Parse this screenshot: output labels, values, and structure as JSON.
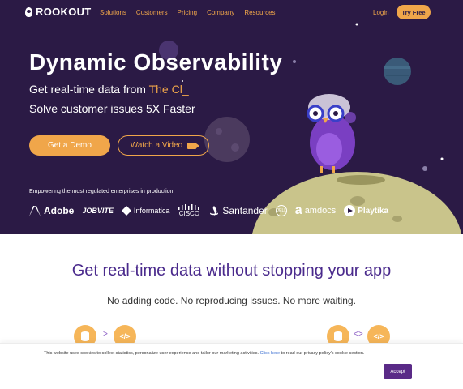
{
  "nav": {
    "logo_text": "ROOKOUT",
    "menu": [
      "Solutions",
      "Customers",
      "Pricing",
      "Company",
      "Resources"
    ],
    "login": "Login",
    "try_free": "Try Free"
  },
  "hero": {
    "title": "Dynamic Observability",
    "subtitle_prefix": "Get real-time data from ",
    "subtitle_highlight": "The Cl_",
    "subtitle_line2": "Solve customer issues 5X Faster",
    "get_demo": "Get a Demo",
    "watch_video": "Watch a Video",
    "empower_text": "Empowering the most regulated enterprises in production",
    "logos": [
      "Adobe",
      "JOBVITE",
      "Informatica",
      "CISCO",
      "Santander",
      "DELL",
      "amdocs",
      "Playtika"
    ]
  },
  "section": {
    "heading": "Get real-time data without stopping your app",
    "subheading": "No adding code. No reproducing issues. No more waiting.",
    "arrow1": ">",
    "arrow2": "<>",
    "code_icon": "</>"
  },
  "cookie": {
    "text_before": "This website uses cookies to collect statistics, personalize user experience and tailor our marketing activities. ",
    "link": "Click here",
    "text_after": " to read our privacy policy's cookie section.",
    "accept": "Accept"
  },
  "colors": {
    "hero_bg": "#2b1a45",
    "accent": "#f0a64a",
    "heading_purple": "#4a2a8c",
    "accept_bg": "#5a2a87"
  }
}
